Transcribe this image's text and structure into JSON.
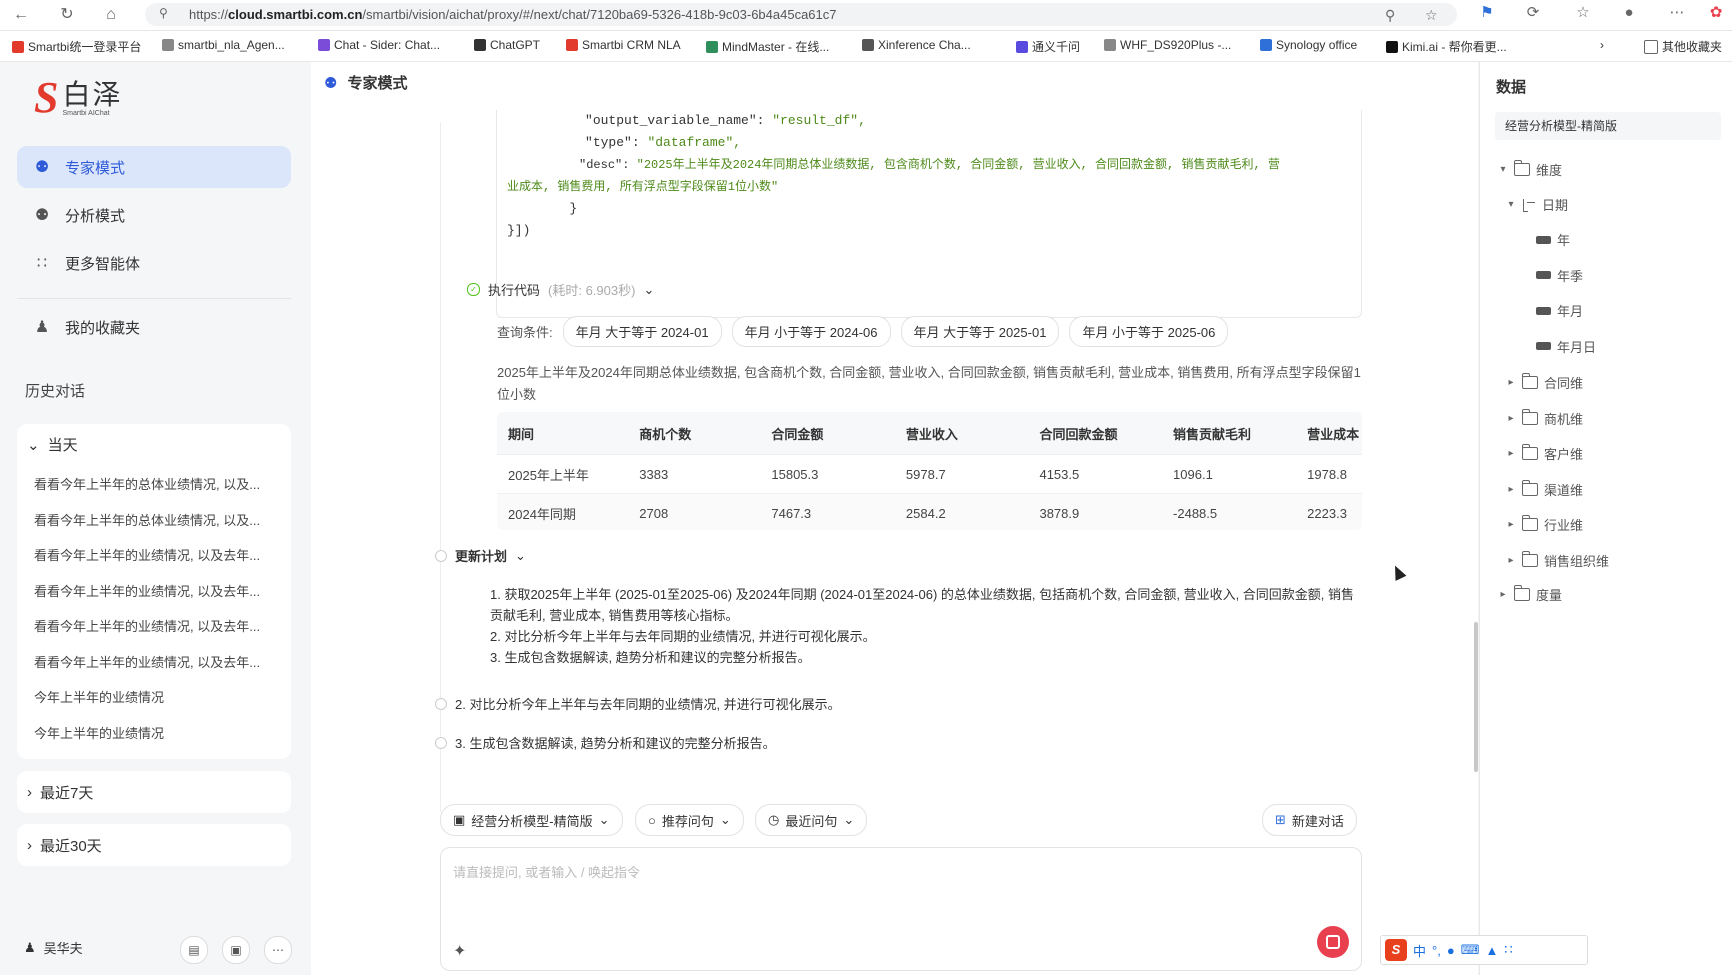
{
  "browser": {
    "url_host": "cloud.smartbi.com.cn",
    "url_prefix": "https://",
    "url_path": "/smartbi/vision/aichat/proxy/#/next/chat/7120ba69-5326-418b-9c03-6b4a45ca61c7",
    "bookmarks": [
      {
        "label": "Smartbi统一登录平台",
        "color": "#e23b2e"
      },
      {
        "label": "smartbi_nla_Agen...",
        "color": "#888"
      },
      {
        "label": "Chat - Sider: Chat...",
        "color": "#7b4cd8"
      },
      {
        "label": "ChatGPT",
        "color": "#333"
      },
      {
        "label": "Smartbi CRM NLA",
        "color": "#e23b2e"
      },
      {
        "label": "MindMaster - 在线...",
        "color": "#2f8f5b"
      },
      {
        "label": "Xinference Cha...",
        "color": "#555"
      },
      {
        "label": "通义千问",
        "color": "#5a4be0"
      },
      {
        "label": "WHF_DS920Plus -...",
        "color": "#888"
      },
      {
        "label": "Synology office",
        "color": "#2f6fd8"
      },
      {
        "label": "Kimi.ai - 帮你看更...",
        "color": "#111"
      }
    ],
    "other_bookmarks": "其他收藏夹"
  },
  "sidebar": {
    "logo_text": "白泽",
    "logo_sub": "Smartbi AIChat",
    "nav": [
      {
        "label": "专家模式",
        "icon": "robot-icon"
      },
      {
        "label": "分析模式",
        "icon": "robot-icon"
      },
      {
        "label": "更多智能体",
        "icon": "grid-icon"
      }
    ],
    "favorites": "我的收藏夹",
    "history_title": "历史对话",
    "today": "当天",
    "today_items": [
      "看看今年上半年的总体业绩情况, 以及...",
      "看看今年上半年的总体业绩情况, 以及...",
      "看看今年上半年的业绩情况, 以及去年...",
      "看看今年上半年的业绩情况, 以及去年...",
      "看看今年上半年的业绩情况, 以及去年...",
      "看看今年上半年的业绩情况, 以及去年...",
      "今年上半年的业绩情况",
      "今年上半年的业绩情况"
    ],
    "last7": "最近7天",
    "last30": "最近30天",
    "user": "吴华夫"
  },
  "main": {
    "title": "专家模式",
    "code_lines": [
      {
        "key": "\"output_variable_name\": ",
        "val": "\"result_df\","
      },
      {
        "key": "\"type\": ",
        "val": "\"dataframe\","
      },
      {
        "key": "\"desc\": ",
        "val": "\"2025年上半年及2024年同期总体业绩数据, 包含商机个数, 合同金额, 营业收入, 合同回款金额, 销售贡献毛利, 营"
      },
      {
        "key": "",
        "val": "业成本, 销售费用, 所有浮点型字段保留1位小数\""
      }
    ],
    "code_close1": "}",
    "code_close2": "}])",
    "exec_label": "执行代码",
    "exec_time": "(耗时: 6.903秒)",
    "cond_label": "查询条件:",
    "conditions": [
      "年月  大于等于  2024-01",
      "年月  小于等于  2024-06",
      "年月  大于等于  2025-01",
      "年月  小于等于  2025-06"
    ],
    "table_desc": "2025年上半年及2024年同期总体业绩数据, 包含商机个数, 合同金额, 营业收入, 合同回款金额, 销售贡献毛利, 营业成本, 销售费用, 所有浮点型字段保留1位小数",
    "table_headers": [
      "期间",
      "商机个数",
      "合同金额",
      "营业收入",
      "合同回款金额",
      "销售贡献毛利",
      "营业成本"
    ],
    "table_rows": [
      [
        "2025年上半年",
        "3383",
        "15805.3",
        "5978.7",
        "4153.5",
        "1096.1",
        "1978.8"
      ],
      [
        "2024年同期",
        "2708",
        "7467.3",
        "2584.2",
        "3878.9",
        "-2488.5",
        "2223.3"
      ]
    ],
    "plan_label": "更新计划",
    "plan_items": [
      "1. 获取2025年上半年 (2025-01至2025-06) 及2024年同期 (2024-01至2024-06) 的总体业绩数据, 包括商机个数, 合同金额, 营业收入, 合同回款金额, 销售贡献毛利, 营业成本, 销售费用等核心指标。",
      "2. 对比分析今年上半年与去年同期的业绩情况, 并进行可视化展示。",
      "3. 生成包含数据解读, 趋势分析和建议的完整分析报告。"
    ],
    "step2": "2. 对比分析今年上半年与去年同期的业绩情况, 并进行可视化展示。",
    "step3": "3. 生成包含数据解读, 趋势分析和建议的完整分析报告。",
    "model_pill": "经营分析模型-精简版",
    "recommend_pill": "推荐问句",
    "recent_pill": "最近问句",
    "new_chat": "新建对话",
    "input_placeholder": "请直接提问, 或者输入 / 唤起指令"
  },
  "right": {
    "title": "数据",
    "model": "经营分析模型-精简版",
    "tree": {
      "dimension": "维度",
      "date": "日期",
      "date_children": [
        "年",
        "年季",
        "年月",
        "年月日"
      ],
      "groups": [
        "合同维",
        "商机维",
        "客户维",
        "渠道维",
        "行业维",
        "销售组织维"
      ],
      "measure": "度量"
    }
  },
  "ime": "中"
}
